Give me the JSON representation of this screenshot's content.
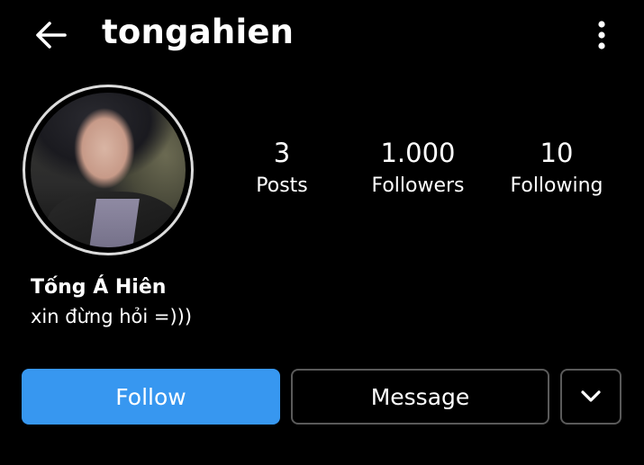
{
  "header": {
    "username": "tongahien",
    "back_icon": "arrow-left-icon",
    "more_icon": "more-vertical-icon"
  },
  "profile": {
    "display_name": "Tống Á Hiên",
    "bio": "xin đừng hỏi =)))",
    "avatar_icon": "profile-avatar"
  },
  "stats": {
    "posts": {
      "value": "3",
      "label": "Posts"
    },
    "followers": {
      "value": "1.000",
      "label": "Followers"
    },
    "following": {
      "value": "10",
      "label": "Following"
    }
  },
  "actions": {
    "follow_label": "Follow",
    "message_label": "Message",
    "more_icon": "chevron-down-icon"
  },
  "colors": {
    "background": "#000000",
    "primary_button": "#3797f0",
    "text": "#ffffff",
    "border": "#5a5a5a"
  }
}
